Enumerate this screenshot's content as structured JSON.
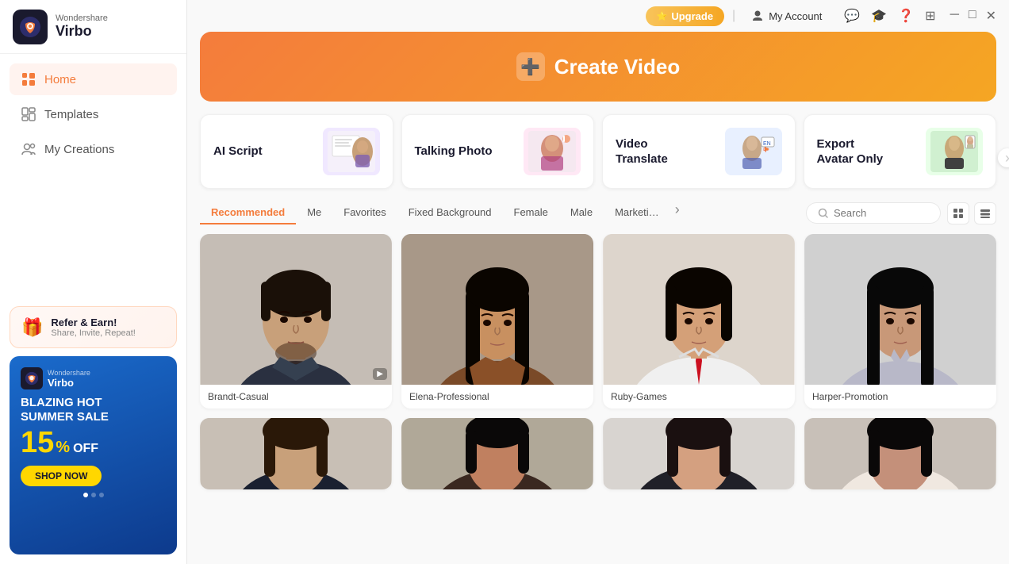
{
  "app": {
    "brand": "Wondershare",
    "name": "Virbo"
  },
  "titlebar": {
    "upgrade_label": "Upgrade",
    "my_account_label": "My Account",
    "separator": "|"
  },
  "sidebar": {
    "nav_items": [
      {
        "id": "home",
        "label": "Home",
        "active": true
      },
      {
        "id": "templates",
        "label": "Templates",
        "active": false
      },
      {
        "id": "my-creations",
        "label": "My Creations",
        "active": false
      }
    ],
    "refer": {
      "title": "Refer & Earn!",
      "subtitle": "Share, Invite, Repeat!"
    },
    "promo": {
      "brand": "Wondershare",
      "name": "Virbo",
      "headline": "BLAZING HOT\nSUMMER SALE",
      "percent": "15",
      "off_label": "%\nOFF",
      "button_label": "SHOP NOW"
    }
  },
  "banner": {
    "icon": "➕",
    "title": "Create Video"
  },
  "feature_cards": [
    {
      "id": "ai-script",
      "label": "AI Script"
    },
    {
      "id": "talking-photo",
      "label": "Talking Photo"
    },
    {
      "id": "video-translate",
      "label": "Video\nTranslate"
    },
    {
      "id": "export-avatar",
      "label": "Export\nAvatar Only"
    }
  ],
  "filters": {
    "tabs": [
      {
        "id": "recommended",
        "label": "Recommended",
        "active": true
      },
      {
        "id": "me",
        "label": "Me",
        "active": false
      },
      {
        "id": "favorites",
        "label": "Favorites",
        "active": false
      },
      {
        "id": "fixed-bg",
        "label": "Fixed Background",
        "active": false
      },
      {
        "id": "female",
        "label": "Female",
        "active": false
      },
      {
        "id": "male",
        "label": "Male",
        "active": false
      },
      {
        "id": "marketing",
        "label": "Marketi…",
        "active": false
      }
    ],
    "search_placeholder": "Search"
  },
  "avatars": [
    {
      "id": "brandt",
      "name": "Brandt-Casual",
      "bg": "#d4c9be",
      "skin": "#c8a07a",
      "hair": "#2a1a0a",
      "outfit": "#2a3a4a"
    },
    {
      "id": "elena",
      "name": "Elena-Professional",
      "bg": "#b8a898",
      "skin": "#c89060",
      "hair": "#1a0a00",
      "outfit": "#6b4020"
    },
    {
      "id": "ruby",
      "name": "Ruby-Games",
      "bg": "#e8e0d8",
      "skin": "#d4a078",
      "hair": "#1a0a00",
      "outfit": "#f0f0f0"
    },
    {
      "id": "harper",
      "name": "Harper-Promotion",
      "bg": "#d8d8d8",
      "skin": "#c89878",
      "hair": "#0a0a0a",
      "outfit": "#c0c0c8"
    },
    {
      "id": "avatar5",
      "name": "",
      "bg": "#e0d4c8",
      "skin": "#c8a07a",
      "hair": "#2a1808",
      "outfit": "#1a1a2a"
    },
    {
      "id": "avatar6",
      "name": "",
      "bg": "#c8c0b8",
      "skin": "#c08060",
      "hair": "#0a0808",
      "outfit": "#3a3030"
    },
    {
      "id": "avatar7",
      "name": "",
      "bg": "#e0dcd8",
      "skin": "#d4a080",
      "hair": "#1a1010",
      "outfit": "#202028"
    },
    {
      "id": "avatar8",
      "name": "",
      "bg": "#d4c8c0",
      "skin": "#c4907a",
      "hair": "#0a0808",
      "outfit": "#f0e8e0"
    }
  ]
}
